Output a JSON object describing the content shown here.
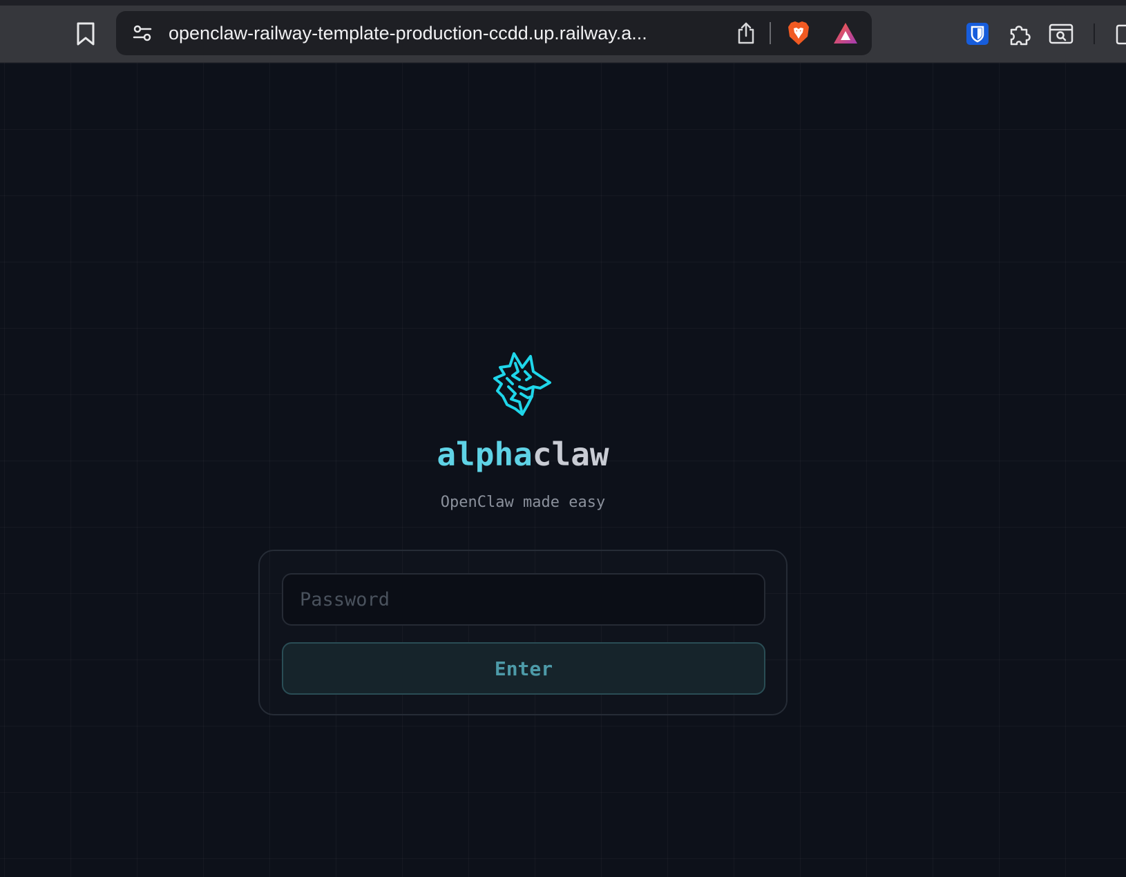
{
  "browser": {
    "url": "openclaw-railway-template-production-ccdd.up.railway.a...",
    "icons": [
      "bookmark-icon",
      "tune-icon",
      "share-icon",
      "brave-shields-icon",
      "brave-rewards-icon",
      "bitwarden-icon",
      "extensions-icon",
      "tab-search-icon",
      "sidebar-icon"
    ]
  },
  "login": {
    "brand_part1": "alpha",
    "brand_part2": "claw",
    "tagline": "OpenClaw made easy",
    "password_placeholder": "Password",
    "enter_label": "Enter"
  },
  "colors": {
    "background": "#0d111a",
    "accent": "#5fd3e6",
    "logo": "#1fd6ea",
    "button_text": "#4d9aa8"
  }
}
